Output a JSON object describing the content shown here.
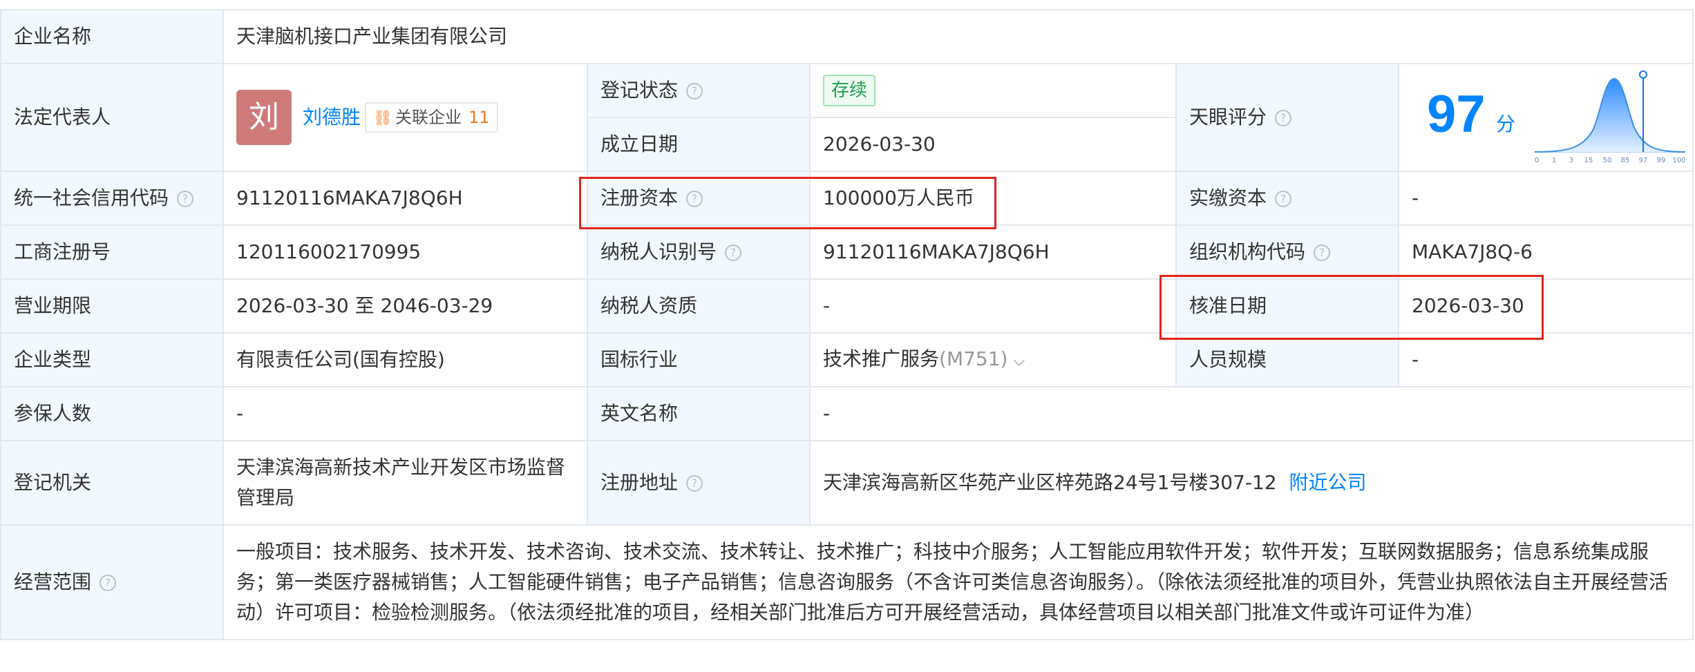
{
  "company": {
    "label": "企业名称",
    "value": "天津脑机接口产业集团有限公司"
  },
  "legal_rep": {
    "label": "法定代表人",
    "avatar_char": "刘",
    "name": "刘德胜",
    "assoc_label": "关联企业",
    "assoc_count": "11"
  },
  "reg_status": {
    "label": "登记状态",
    "value": "存续"
  },
  "founded": {
    "label": "成立日期",
    "value": "2026-03-30"
  },
  "tianyan": {
    "label": "天眼评分",
    "score": "97",
    "unit": "分",
    "ticks": [
      "0",
      "1",
      "3",
      "15",
      "50",
      "85",
      "97",
      "99",
      "100"
    ]
  },
  "credit_code": {
    "label": "统一社会信用代码",
    "value": "91120116MAKA7J8Q6H"
  },
  "reg_capital": {
    "label": "注册资本",
    "value": "100000万人民币"
  },
  "paid_capital": {
    "label": "实缴资本",
    "value": "-"
  },
  "biz_reg_no": {
    "label": "工商注册号",
    "value": "120116002170995"
  },
  "taxpayer_id": {
    "label": "纳税人识别号",
    "value": "91120116MAKA7J8Q6H"
  },
  "org_code": {
    "label": "组织机构代码",
    "value": "MAKA7J8Q-6"
  },
  "biz_term": {
    "label": "营业期限",
    "value": "2026-03-30 至 2046-03-29"
  },
  "taxpayer_qual": {
    "label": "纳税人资质",
    "value": "-"
  },
  "approve_date": {
    "label": "核准日期",
    "value": "2026-03-30"
  },
  "company_type": {
    "label": "企业类型",
    "value": "有限责任公司(国有控股)"
  },
  "industry": {
    "label": "国标行业",
    "value": "技术推广服务",
    "code": "(M751)"
  },
  "staff_size": {
    "label": "人员规模",
    "value": "-"
  },
  "insured": {
    "label": "参保人数",
    "value": "-"
  },
  "english_name": {
    "label": "英文名称",
    "value": "-"
  },
  "reg_authority": {
    "label": "登记机关",
    "value": "天津滨海高新技术产业开发区市场监督管理局"
  },
  "reg_address": {
    "label": "注册地址",
    "value": "天津滨海高新区华苑产业区梓苑路24号1号楼307-12",
    "nearby": "附近公司"
  },
  "biz_scope": {
    "label": "经营范围",
    "value": "一般项目：技术服务、技术开发、技术咨询、技术交流、技术转让、技术推广；科技中介服务；人工智能应用软件开发；软件开发；互联网数据服务；信息系统集成服务；第一类医疗器械销售；人工智能硬件销售；电子产品销售；信息咨询服务（不含许可类信息咨询服务）。（除依法须经批准的项目外，凭营业执照依法自主开展经营活动）许可项目：检验检测服务。（依法须经批准的项目，经相关部门批准后方可开展经营活动，具体经营项目以相关部门批准文件或许可证件为准）"
  },
  "colors": {
    "label_bg": "#f2f8ff",
    "border": "#e3e8ee",
    "accent": "#0084ff",
    "highlight": "#e1251b",
    "status_green": "#1e9e4d",
    "assoc_orange": "#f07b21"
  }
}
